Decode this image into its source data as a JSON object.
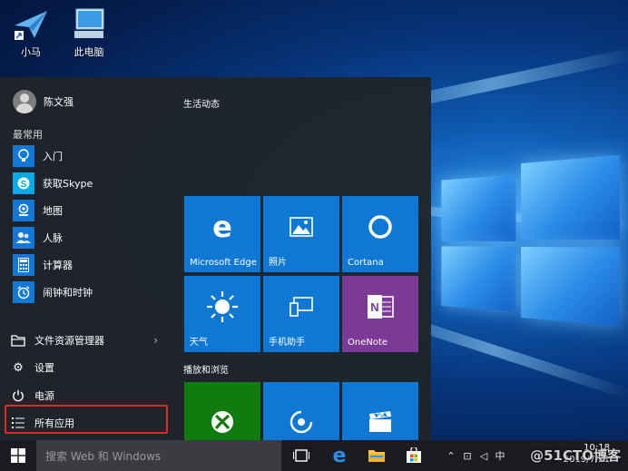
{
  "desktop": {
    "icons": [
      {
        "label": "小马",
        "icon": "paper-plane-icon"
      },
      {
        "label": "此电脑",
        "icon": "computer-icon"
      }
    ]
  },
  "start_menu": {
    "user_name": "陈文强",
    "most_used_label": "最常用",
    "apps": [
      {
        "label": "入门",
        "icon": "lightbulb-icon"
      },
      {
        "label": "获取Skype",
        "icon": "skype-icon"
      },
      {
        "label": "地图",
        "icon": "map-icon"
      },
      {
        "label": "人脉",
        "icon": "people-icon"
      },
      {
        "label": "计算器",
        "icon": "calculator-icon"
      },
      {
        "label": "闹钟和时钟",
        "icon": "alarm-icon"
      }
    ],
    "system_items": [
      {
        "label": "文件资源管理器",
        "icon": "folder-icon"
      },
      {
        "label": "设置",
        "icon": "gear-icon"
      },
      {
        "label": "电源",
        "icon": "power-icon"
      },
      {
        "label": "所有应用",
        "icon": "list-icon"
      }
    ],
    "tile_groups": [
      {
        "label": "生活动态"
      },
      {
        "label": "播放和浏览"
      }
    ],
    "tiles": [
      {
        "label": "Microsoft Edge",
        "color": "#0f78d4",
        "icon": "edge-icon"
      },
      {
        "label": "照片",
        "color": "#0f78d4",
        "icon": "photos-icon"
      },
      {
        "label": "Cortana",
        "color": "#0f78d4",
        "icon": "cortana-icon"
      },
      {
        "label": "天气",
        "color": "#0f78d4",
        "icon": "weather-sun-icon"
      },
      {
        "label": "手机助手",
        "color": "#0f78d4",
        "icon": "phone-companion-icon"
      },
      {
        "label": "OneNote",
        "color": "#7b3a96",
        "icon": "onenote-icon"
      },
      {
        "label": "",
        "color": "#107c10",
        "icon": "xbox-icon"
      },
      {
        "label": "",
        "color": "#0f78d4",
        "icon": "groove-music-icon"
      },
      {
        "label": "",
        "color": "#0f78d4",
        "icon": "movies-tv-icon"
      }
    ]
  },
  "taskbar": {
    "search_placeholder": "搜索 Web 和 Windows",
    "clock_time": "10:18",
    "clock_date": "2019/7/21",
    "watermark": "@51CTO博客"
  }
}
